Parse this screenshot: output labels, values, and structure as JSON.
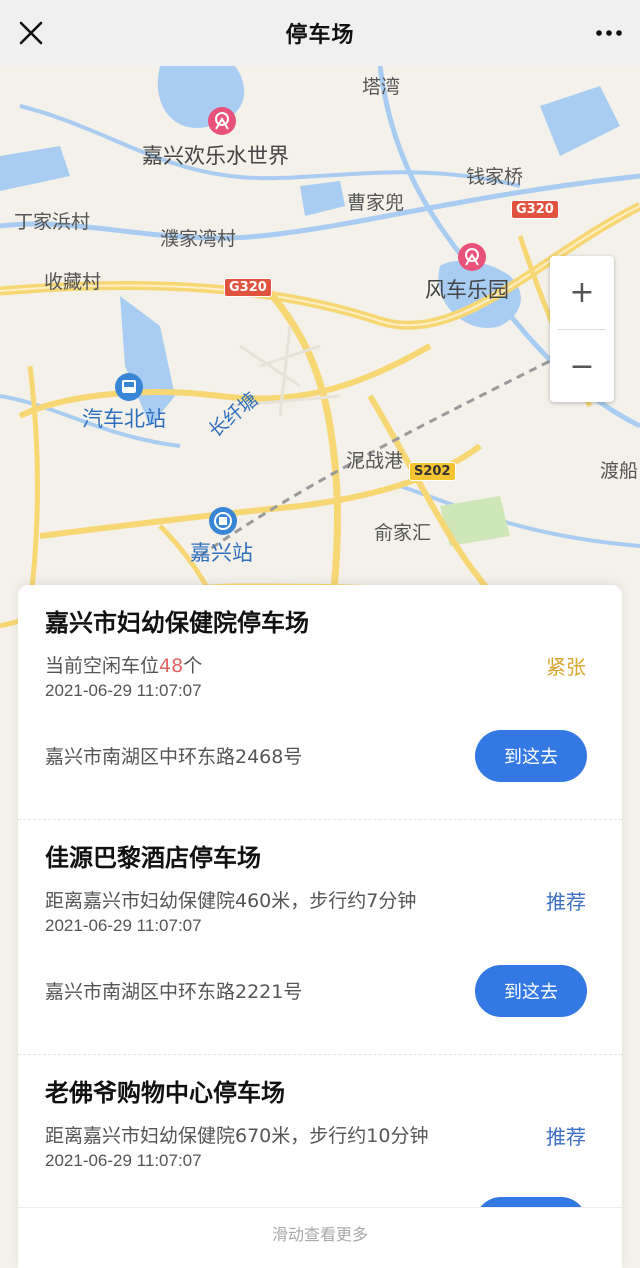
{
  "header": {
    "title": "停车场",
    "close_icon": "close-icon",
    "more_icon": "more-dots-icon"
  },
  "map": {
    "labels": {
      "tawan": "塔湾",
      "jiaxing_water_park": "嘉兴欢乐水世界",
      "qianjiaqiao": "钱家桥",
      "caojiadou": "曹家兜",
      "dingjiabang": "丁家浜村",
      "pujiawan": "濮家湾村",
      "shoucang": "收藏村",
      "windmill_park": "风车乐园",
      "bus_north": "汽车北站",
      "changxiantang": "长纤塘",
      "nianzhangang": "泥战港",
      "yujiahui": "俞家汇",
      "jiaxing_station": "嘉兴站",
      "duchuan": "渡船"
    },
    "shields": {
      "g320_left": "G320",
      "g320_right": "G320",
      "s202": "S202"
    },
    "zoom_in": "+",
    "zoom_out": "−",
    "colors": {
      "road": "#f7d774",
      "water": "#a9cdf2",
      "land": "#f3f1ea"
    }
  },
  "parking_list": [
    {
      "name": "嘉兴市妇幼保健院停车场",
      "desc_prefix": "当前空闲车位",
      "desc_num": "48",
      "desc_suffix": "个",
      "tag": "紧张",
      "tag_color": "#d9a72f",
      "time": "2021-06-29 11:07:07",
      "address": "嘉兴市南湖区中环东路2468号",
      "go_label": "到这去"
    },
    {
      "name": "佳源巴黎酒店停车场",
      "desc": "距离嘉兴市妇幼保健院460米，步行约7分钟",
      "tag": "推荐",
      "tag_color": "#3b6fbf",
      "time": "2021-06-29 11:07:07",
      "address": "嘉兴市南湖区中环东路2221号",
      "go_label": "到这去"
    },
    {
      "name": "老佛爷购物中心停车场",
      "desc": "距离嘉兴市妇幼保健院670米，步行约10分钟",
      "tag": "推荐",
      "tag_color": "#3b6fbf",
      "time": "2021-06-29 11:07:07"
    }
  ],
  "footer": {
    "label": "滑动查看更多"
  }
}
